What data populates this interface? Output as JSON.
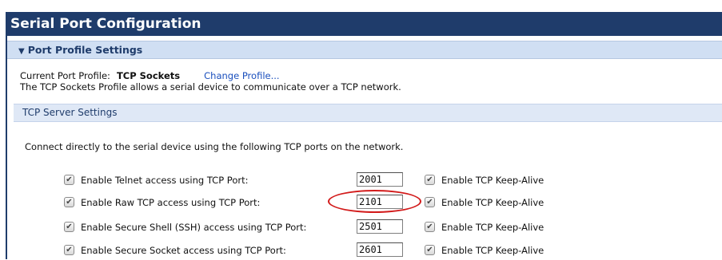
{
  "page": {
    "title": "Serial Port Configuration"
  },
  "section": {
    "title": "Port Profile Settings",
    "expanded": true
  },
  "profile": {
    "current_label": "Current Port Profile:",
    "current_value": "TCP Sockets",
    "change_link": "Change Profile...",
    "description": "The TCP Sockets Profile allows a serial device to communicate over a TCP network."
  },
  "tcp_server": {
    "title": "TCP Server Settings",
    "intro": "Connect directly to the serial device using the following TCP ports on the network.",
    "rows": [
      {
        "label": "Enable Telnet access using TCP Port:",
        "enabled": true,
        "port": "2001",
        "keepalive_label": "Enable TCP Keep-Alive",
        "keepalive": true
      },
      {
        "label": "Enable Raw TCP access using TCP Port:",
        "enabled": true,
        "port": "2101",
        "keepalive_label": "Enable TCP Keep-Alive",
        "keepalive": true
      },
      {
        "label": "Enable Secure Shell (SSH) access using TCP Port:",
        "enabled": true,
        "port": "2501",
        "keepalive_label": "Enable TCP Keep-Alive",
        "keepalive": true
      },
      {
        "label": "Enable Secure Socket access using TCP Port:",
        "enabled": true,
        "port": "2601",
        "keepalive_label": "Enable TCP Keep-Alive",
        "keepalive": true
      }
    ]
  },
  "icons": {
    "expand": "triangle-down-icon",
    "check": "checkmark-icon"
  },
  "colors": {
    "title_bar": "#1f3c6b",
    "section_header": "#d0dff3",
    "highlight": "#d21a1a",
    "link": "#1a4fbd"
  }
}
